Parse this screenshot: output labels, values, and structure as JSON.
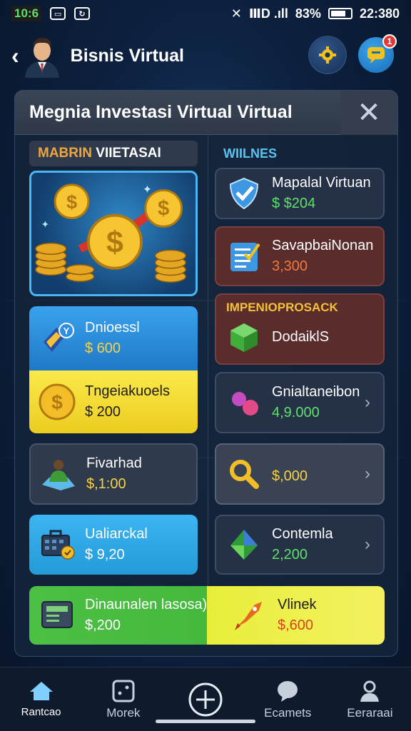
{
  "status_bar": {
    "time": "10:6",
    "indicators": "ⅢD .ıll",
    "battery": "83%",
    "clock": "22:380"
  },
  "header": {
    "back_icon": "chevron-left-icon",
    "title": "Bisnis Virtual"
  },
  "panel": {
    "title": "Megnia Investasi Virtual Virtual",
    "left_section": {
      "label_a": "MABRIN",
      "label_b": " VIIETASAI"
    },
    "right_section": {
      "label": "WIILNES"
    },
    "left_cards": [
      {
        "name": "Dnioessl",
        "value": "$ 600"
      },
      {
        "name": "Tngeiakuoels",
        "value": "$ 200"
      },
      {
        "name": "Fivarhad",
        "value": "$,1:00"
      },
      {
        "name": "Ualiarckal",
        "value": "$ 9,20"
      }
    ],
    "right_cards": [
      {
        "name": "Mapalal Virtuan",
        "value": "$ $204"
      },
      {
        "name": "SavapbaiNonan",
        "value": "3,300"
      },
      {
        "name": "IMPENIOPROSACK",
        "value": "DodaiklS"
      },
      {
        "name": "Gnialtaneibon",
        "value": "4,9.000"
      },
      {
        "name": "",
        "value": "$,000"
      },
      {
        "name": "Contemla",
        "value": "2,200"
      }
    ],
    "wide_card": {
      "left_name": "Dinaunalen lasosa)",
      "left_value": "$,200",
      "right_name": "Vlinek",
      "right_value": "$,600"
    }
  },
  "bottom_nav": [
    {
      "label": "Rantcao",
      "icon": "home-icon"
    },
    {
      "label": "Morek",
      "icon": "dice-icon"
    },
    {
      "label": "",
      "icon": "add-circle-icon"
    },
    {
      "label": "Ecamets",
      "icon": "chat-bubble-icon"
    },
    {
      "label": "Eeraraai",
      "icon": "profile-icon"
    }
  ],
  "colors": {
    "accent_blue": "#2b8fd9",
    "yellow": "#f7e23a",
    "green": "#53c94a",
    "red_card": "#5a2c2c"
  }
}
